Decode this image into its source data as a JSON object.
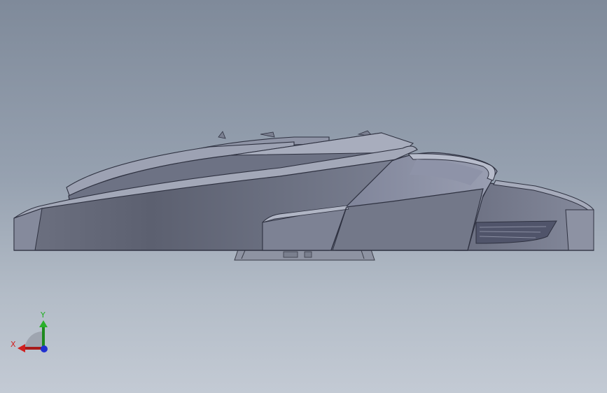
{
  "viewport": {
    "background_top": "#7f8a9a",
    "background_bottom": "#c3cad4",
    "model": "cad-shell-part-side-view"
  },
  "triad": {
    "x_label": "X",
    "y_label": "Y",
    "x_color": "#d02020",
    "y_color": "#20b020",
    "z_color": "#2030d0"
  }
}
